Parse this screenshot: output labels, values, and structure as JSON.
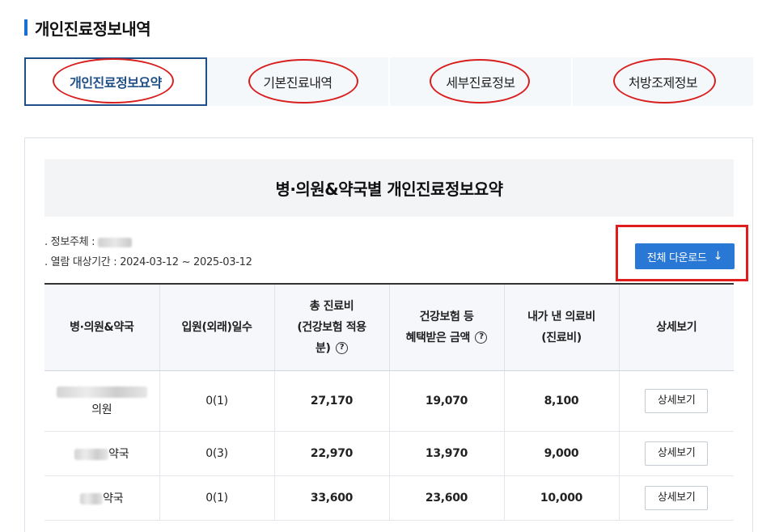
{
  "page_title": "개인진료정보내역",
  "tabs": [
    {
      "label": "개인진료정보요약",
      "active": true
    },
    {
      "label": "기본진료내역",
      "active": false
    },
    {
      "label": "세부진료정보",
      "active": false
    },
    {
      "label": "처방조제정보",
      "active": false
    }
  ],
  "panel_title": "병·의원&약국별 개인진료정보요약",
  "info": {
    "subject_label": ". 정보주체 :",
    "period_label": ". 열람 대상기간 : 2024-03-12 ~ 2025-03-12"
  },
  "download_button": "전체 다운로드",
  "table": {
    "headers": {
      "h1": "병·의원&약국",
      "h2": "입원(외래)일수",
      "h3_l1": "총 진료비",
      "h3_l2": "(건강보험 적용",
      "h3_l3": "분)",
      "h4_l1": "건강보험 등",
      "h4_l2": "혜택받은 금액",
      "h5_l1": "내가 낸 의료비",
      "h5_l2": "(진료비)",
      "h6": "상세보기"
    },
    "rows": [
      {
        "name_suffix": "의원",
        "days": "0(1)",
        "total": "27,170",
        "benefit": "19,070",
        "paid": "8,100",
        "detail": "상세보기"
      },
      {
        "name_suffix": "약국",
        "days": "0(3)",
        "total": "22,970",
        "benefit": "13,970",
        "paid": "9,000",
        "detail": "상세보기"
      },
      {
        "name_suffix": "약국",
        "days": "0(1)",
        "total": "33,600",
        "benefit": "23,600",
        "paid": "10,000",
        "detail": "상세보기"
      }
    ]
  },
  "icons": {
    "help": "question-circle-icon",
    "download": "arrow-down-icon"
  },
  "colors": {
    "accent": "#1a6fd3",
    "active_tab": "#1f4f86",
    "button": "#2a78d6",
    "highlight": "#e01c1c"
  }
}
